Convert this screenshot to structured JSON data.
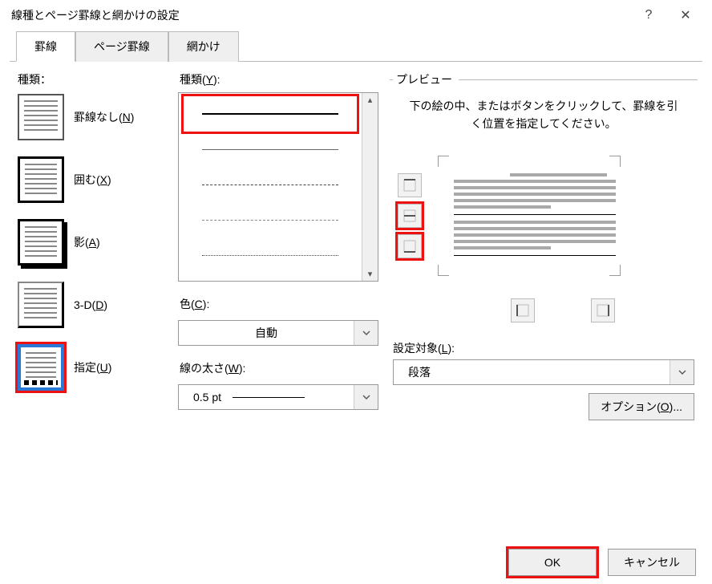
{
  "window": {
    "title": "線種とページ罫線と網かけの設定",
    "help_icon": "?",
    "close_icon": "✕"
  },
  "tabs": [
    {
      "label": "罫線",
      "active": true
    },
    {
      "label": "ページ罫線",
      "active": false
    },
    {
      "label": "網かけ",
      "active": false
    }
  ],
  "left": {
    "heading": "種類：",
    "settings": [
      {
        "id": "none",
        "label_pre": "罫線なし(",
        "accel": "N",
        "label_post": ")"
      },
      {
        "id": "box",
        "label_pre": "囲む(",
        "accel": "X",
        "label_post": ")"
      },
      {
        "id": "shadow",
        "label_pre": "影(",
        "accel": "A",
        "label_post": ")"
      },
      {
        "id": "threeD",
        "label_pre": "3-D(",
        "accel": "D",
        "label_post": ")"
      },
      {
        "id": "custom",
        "label_pre": "指定(",
        "accel": "U",
        "label_post": ")",
        "selected": true
      }
    ]
  },
  "mid": {
    "style_heading_pre": "種類(",
    "style_heading_accel": "Y",
    "style_heading_post": "):",
    "color_heading_pre": "色(",
    "color_heading_accel": "C",
    "color_heading_post": "):",
    "color_value": "自動",
    "width_heading_pre": "線の太さ(",
    "width_heading_accel": "W",
    "width_heading_post": "):",
    "width_value": "0.5 pt"
  },
  "right": {
    "preview_legend": "プレビュー",
    "instruction": "下の絵の中、またはボタンをクリックして、罫線を引く位置を指定してください。",
    "apply_heading_pre": "設定対象(",
    "apply_heading_accel": "L",
    "apply_heading_post": "):",
    "apply_value": "段落",
    "options_pre": "オプション(",
    "options_accel": "O",
    "options_post": ")..."
  },
  "footer": {
    "ok": "OK",
    "cancel": "キャンセル"
  }
}
